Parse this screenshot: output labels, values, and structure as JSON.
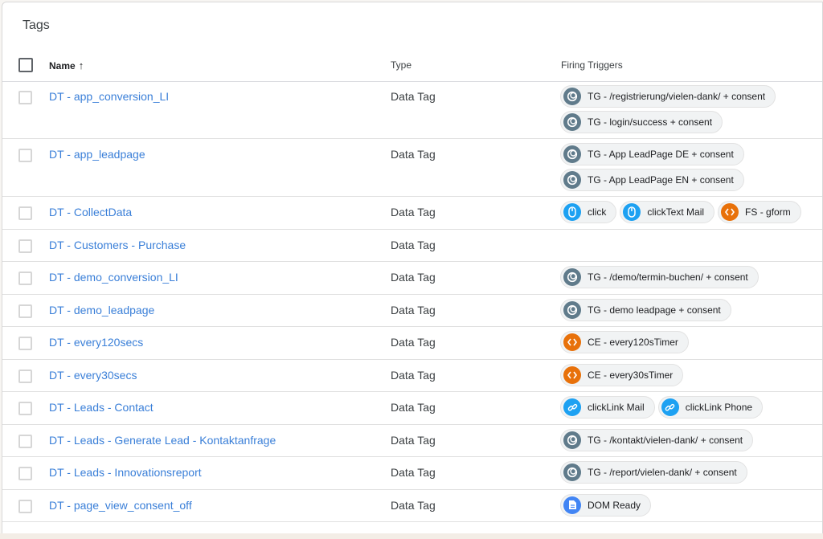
{
  "title": "Tags",
  "columns": {
    "name": "Name",
    "name_sort": "↑",
    "type": "Type",
    "triggers": "Firing Triggers"
  },
  "rows": [
    {
      "name": "DT - app_conversion_LI",
      "type": "Data Tag",
      "triggers": [
        {
          "label": "TG - /registrierung/vielen-dank/ + consent",
          "icon": "trigger-group-icon"
        },
        {
          "label": "TG - login/success + consent",
          "icon": "trigger-group-icon"
        }
      ]
    },
    {
      "name": "DT - app_leadpage",
      "type": "Data Tag",
      "triggers": [
        {
          "label": "TG - App LeadPage DE + consent",
          "icon": "trigger-group-icon"
        },
        {
          "label": "TG - App LeadPage EN + consent",
          "icon": "trigger-group-icon"
        }
      ]
    },
    {
      "name": "DT - CollectData",
      "type": "Data Tag",
      "triggers": [
        {
          "label": "click",
          "icon": "mouse-icon"
        },
        {
          "label": "clickText Mail",
          "icon": "mouse-icon"
        },
        {
          "label": "FS - gform",
          "icon": "code-icon"
        }
      ]
    },
    {
      "name": "DT - Customers - Purchase",
      "type": "Data Tag",
      "triggers": []
    },
    {
      "name": "DT - demo_conversion_LI",
      "type": "Data Tag",
      "triggers": [
        {
          "label": "TG - /demo/termin-buchen/ + consent",
          "icon": "trigger-group-icon"
        }
      ]
    },
    {
      "name": "DT - demo_leadpage",
      "type": "Data Tag",
      "triggers": [
        {
          "label": "TG - demo leadpage + consent",
          "icon": "trigger-group-icon"
        }
      ]
    },
    {
      "name": "DT - every120secs",
      "type": "Data Tag",
      "triggers": [
        {
          "label": "CE - every120sTimer",
          "icon": "code-icon"
        }
      ]
    },
    {
      "name": "DT - every30secs",
      "type": "Data Tag",
      "triggers": [
        {
          "label": "CE - every30sTimer",
          "icon": "code-icon"
        }
      ]
    },
    {
      "name": "DT - Leads - Contact",
      "type": "Data Tag",
      "triggers": [
        {
          "label": "clickLink Mail",
          "icon": "link-icon"
        },
        {
          "label": "clickLink Phone",
          "icon": "link-icon"
        }
      ]
    },
    {
      "name": "DT - Leads - Generate Lead - Kontaktanfrage",
      "type": "Data Tag",
      "triggers": [
        {
          "label": "TG - /kontakt/vielen-dank/ + consent",
          "icon": "trigger-group-icon"
        }
      ]
    },
    {
      "name": "DT - Leads - Innovationsreport",
      "type": "Data Tag",
      "triggers": [
        {
          "label": "TG - /report/vielen-dank/ + consent",
          "icon": "trigger-group-icon"
        }
      ]
    },
    {
      "name": "DT - page_view_consent_off",
      "type": "Data Tag",
      "triggers": [
        {
          "label": "DOM Ready",
          "icon": "document-icon"
        }
      ]
    }
  ]
}
